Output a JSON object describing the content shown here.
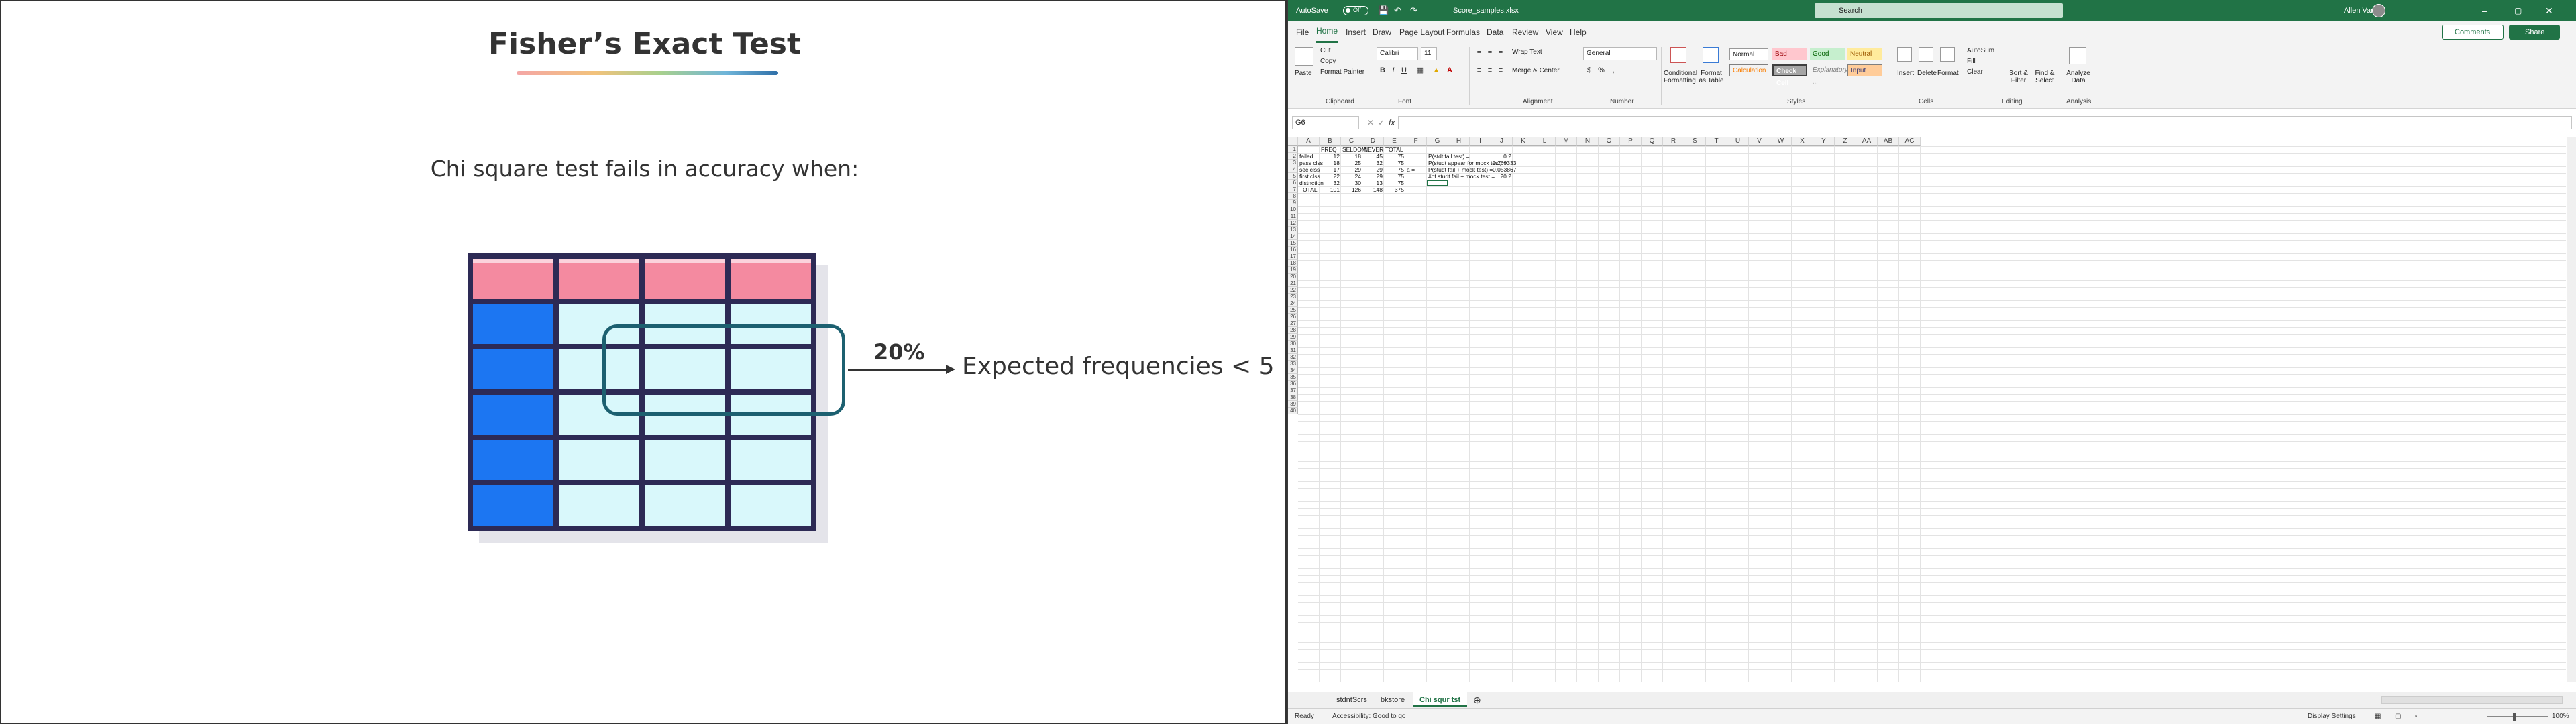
{
  "slide": {
    "title": "Fisher’s Exact Test",
    "subtitle": "Chi square test fails in accuracy when:",
    "percent": "20%",
    "expected_text": "Expected frequencies < 5"
  },
  "excel": {
    "autosave_label": "AutoSave",
    "autosave_state": "Off",
    "file_name": "Score_samples.xlsx",
    "search_placeholder": "Search",
    "user_name": "Allen Vanni",
    "menu": [
      "File",
      "Home",
      "Insert",
      "Draw",
      "Page Layout",
      "Formulas",
      "Data",
      "Review",
      "View",
      "Help"
    ],
    "comments_label": "Comments",
    "share_label": "Share",
    "ribbon": {
      "clipboard": {
        "label": "Clipboard",
        "paste": "Paste",
        "cut": "Cut",
        "copy": "Copy",
        "format_painter": "Format Painter"
      },
      "font": {
        "label": "Font",
        "name": "Calibri",
        "size": "11"
      },
      "alignment": {
        "label": "Alignment",
        "wrap": "Wrap Text",
        "merge": "Merge & Center"
      },
      "number": {
        "label": "Number",
        "format": "General"
      },
      "styles": {
        "label": "Styles",
        "conditional": "Conditional Formatting",
        "format_as_table": "Format as Table",
        "cells": [
          "Normal",
          "Bad",
          "Good",
          "Neutral",
          "Calculation",
          "Check Cell",
          "Explanatory ...",
          "Input"
        ]
      },
      "cells": {
        "label": "Cells",
        "insert": "Insert",
        "delete": "Delete",
        "format": "Format"
      },
      "editing": {
        "label": "Editing",
        "autosum": "AutoSum",
        "fill": "Fill",
        "clear": "Clear",
        "sort": "Sort & Filter",
        "find": "Find & Select"
      },
      "analysis": {
        "label": "Analysis",
        "analyze": "Analyze Data"
      }
    },
    "name_box": "G6",
    "columns": [
      "A",
      "B",
      "C",
      "D",
      "E",
      "F",
      "G",
      "H",
      "I",
      "J",
      "K",
      "L",
      "M",
      "N",
      "O",
      "P",
      "Q",
      "R",
      "S",
      "T",
      "U",
      "V",
      "W",
      "X",
      "Y",
      "Z",
      "AA",
      "AB",
      "AC"
    ],
    "rows": 40,
    "table_header": [
      "",
      "FREQ",
      "SELDOM",
      "NEVER",
      "TOTAL"
    ],
    "table_rows": [
      [
        "failed",
        "12",
        "18",
        "45",
        "75"
      ],
      [
        "pass clss",
        "18",
        "25",
        "32",
        "75"
      ],
      [
        "sec clss",
        "17",
        "29",
        "29",
        "75"
      ],
      [
        "first clss",
        "22",
        "24",
        "29",
        "75"
      ],
      [
        "distnction",
        "32",
        "30",
        "13",
        "75"
      ],
      [
        "TOTAL",
        "101",
        "126",
        "148",
        "375"
      ]
    ],
    "f4_text": "a =",
    "calc_rows": [
      {
        "label": "P(stdt fail test) =",
        "value": "0.2"
      },
      {
        "label": "P(studt appear for mock test) =",
        "value": "0.269333"
      },
      {
        "label": "P(studt fail + mock test) =",
        "value": "0.053867"
      },
      {
        "label": "#of studt fail + mock test =",
        "value": "20.2"
      }
    ],
    "sheets": [
      "stdntScrs",
      "bkstore",
      "Chi squr tst"
    ],
    "active_sheet": "Chi squr tst",
    "status_ready": "Ready",
    "status_accessibility": "Accessibility: Good to go",
    "display_settings": "Display Settings",
    "zoom": "100%"
  }
}
